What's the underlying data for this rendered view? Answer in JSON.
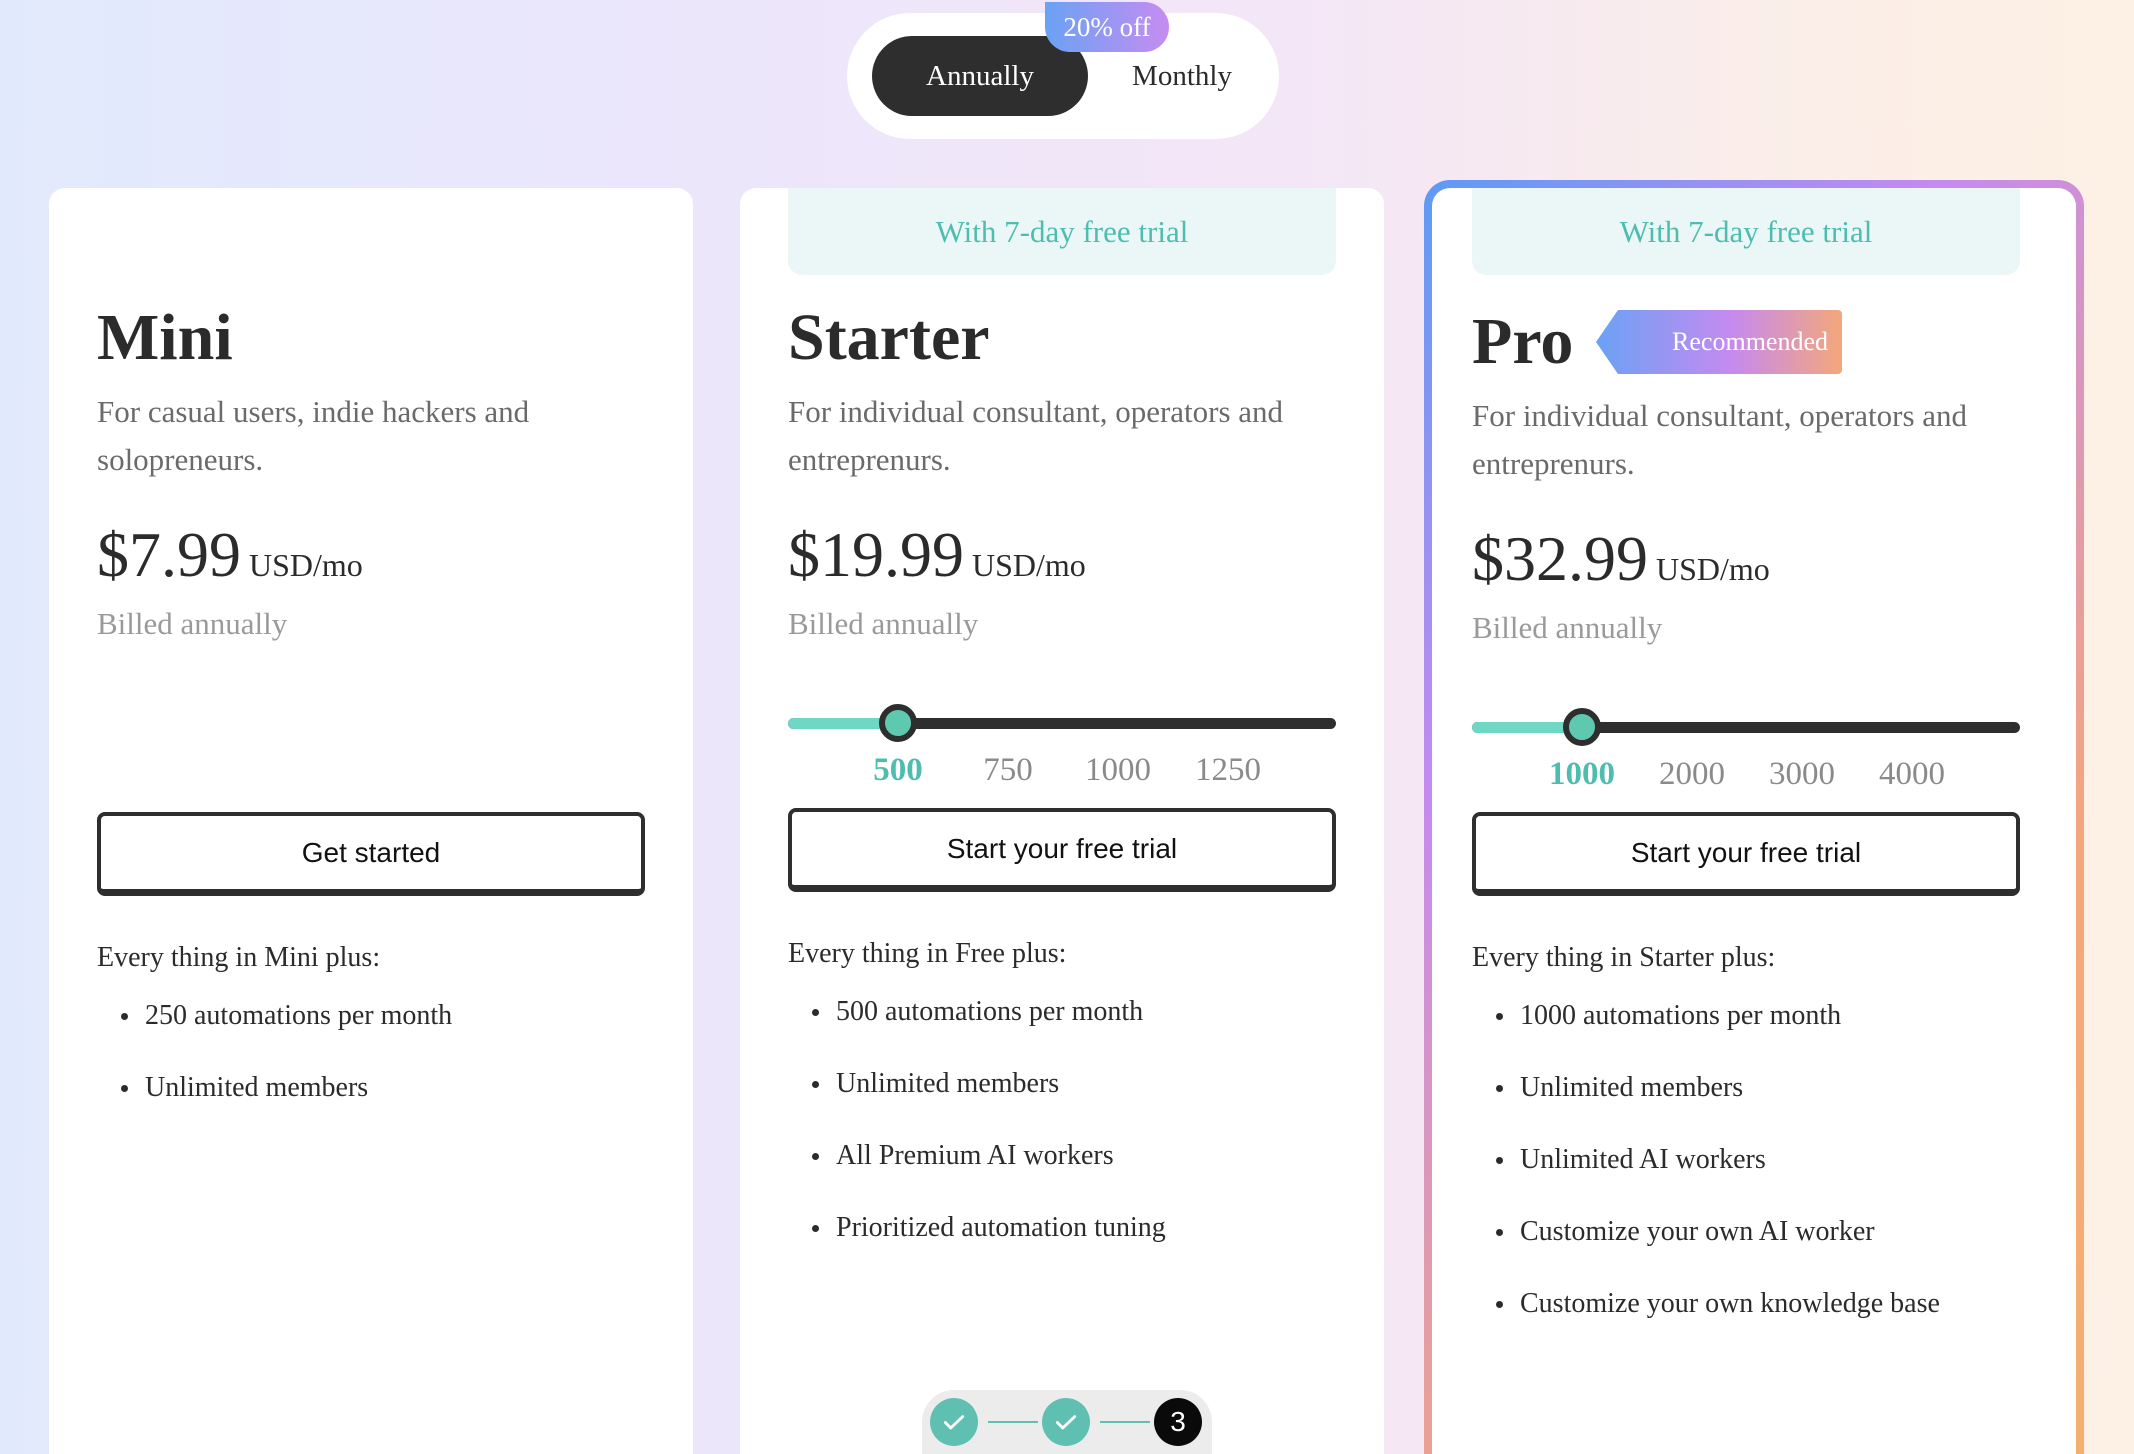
{
  "toggle": {
    "annual_label": "Annually",
    "monthly_label": "Monthly",
    "discount": "20% off",
    "selected": "Annually"
  },
  "plans": [
    {
      "name": "Mini",
      "description": "For casual users, indie hackers and solopreneurs.",
      "price": "$7.99",
      "unit": "USD/mo",
      "billed": "Billed annually",
      "cta": "Get started",
      "features_title": "Every thing in Mini plus:",
      "features": [
        "250 automations per month",
        "Unlimited members"
      ]
    },
    {
      "name": "Starter",
      "trial": "With 7-day free trial",
      "description": "For individual consultant, operators and entreprenurs.",
      "price": "$19.99",
      "unit": "USD/mo",
      "billed": "Billed annually",
      "slider": {
        "ticks": [
          "500",
          "750",
          "1000",
          "1250"
        ],
        "selected": "500"
      },
      "cta": "Start your free trial",
      "features_title": "Every thing in Free plus:",
      "features": [
        "500 automations per month",
        "Unlimited members",
        "All Premium AI workers",
        "Prioritized automation tuning"
      ]
    },
    {
      "name": "Pro",
      "badge": "Recommended",
      "trial": "With 7-day free trial",
      "description": "For individual consultant, operators and entreprenurs.",
      "price": "$32.99",
      "unit": "USD/mo",
      "billed": "Billed annually",
      "slider": {
        "ticks": [
          "1000",
          "2000",
          "3000",
          "4000"
        ],
        "selected": "1000"
      },
      "cta": "Start your free trial",
      "features_title": "Every thing in Starter plus:",
      "features": [
        "1000 automations per month",
        "Unlimited members",
        "Unlimited AI workers",
        "Customize your own AI worker",
        "Customize your own knowledge base"
      ]
    }
  ],
  "stepper": {
    "steps": [
      "done",
      "done",
      "3"
    ],
    "current": "3"
  },
  "colors": {
    "accent_teal": "#4ebdb0",
    "dark": "#2e2e2e",
    "gradient_blue": "#6aa2f4",
    "gradient_purple": "#c58af0",
    "gradient_orange": "#f4a77b"
  }
}
